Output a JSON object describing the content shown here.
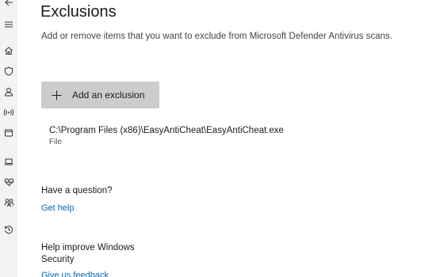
{
  "nav": {
    "items": [
      {
        "id": "back",
        "icon": "back-arrow-icon"
      },
      {
        "id": "menu",
        "icon": "hamburger-menu-icon"
      },
      {
        "id": "home",
        "icon": "home-icon"
      },
      {
        "id": "virus-protection",
        "icon": "shield-icon"
      },
      {
        "id": "account-protection",
        "icon": "person-icon"
      },
      {
        "id": "firewall",
        "icon": "wifi-antenna-icon"
      },
      {
        "id": "app-browser-control",
        "icon": "app-window-icon"
      },
      {
        "id": "device-security",
        "icon": "laptop-icon"
      },
      {
        "id": "device-performance",
        "icon": "heart-pulse-icon"
      },
      {
        "id": "family-options",
        "icon": "family-icon"
      },
      {
        "id": "protection-history",
        "icon": "history-icon"
      }
    ]
  },
  "page": {
    "title": "Exclusions",
    "subtitle": "Add or remove items that you want to exclude from Microsoft Defender Antivirus scans."
  },
  "add_button": {
    "label": "Add an exclusion",
    "icon": "plus-icon"
  },
  "exclusions": [
    {
      "path": "C:\\Program Files (x86)\\EasyAntiCheat\\EasyAntiCheat.exe",
      "type": "File"
    }
  ],
  "help": {
    "heading": "Have a question?",
    "link": "Get help"
  },
  "improve": {
    "heading": "Help improve Windows Security",
    "link": "Give us feedback"
  },
  "colors": {
    "link": "#0067b8",
    "button_bg": "#cccccc",
    "nav_bg": "#f3f3f3"
  }
}
